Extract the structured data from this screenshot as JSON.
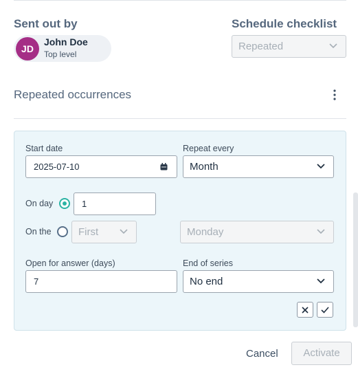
{
  "sent_out_by": {
    "heading": "Sent out by",
    "user": {
      "initials": "JD",
      "name": "John Doe",
      "role": "Top level",
      "avatar_color": "#a52e86"
    }
  },
  "schedule": {
    "heading": "Schedule checklist",
    "mode": "Repeated"
  },
  "occurrences": {
    "title": "Repeated occurrences",
    "menu_icon": "vertical-ellipsis-icon"
  },
  "form": {
    "start_date_label": "Start date",
    "start_date_value": "2025-07-10",
    "repeat_every_label": "Repeat every",
    "repeat_every_value": "Month",
    "on_day_label": "On day",
    "on_day_value": "1",
    "on_day_selected": true,
    "on_the_label": "On the",
    "on_the_ordinal": "First",
    "on_the_weekday": "Monday",
    "on_the_selected": false,
    "open_days_label": "Open for answer (days)",
    "open_days_value": "7",
    "end_series_label": "End of series",
    "end_series_value": "No end"
  },
  "footer": {
    "cancel_label": "Cancel",
    "activate_label": "Activate"
  },
  "colors": {
    "accent": "#2bb3a4",
    "panel_bg": "#ecf6fa"
  }
}
